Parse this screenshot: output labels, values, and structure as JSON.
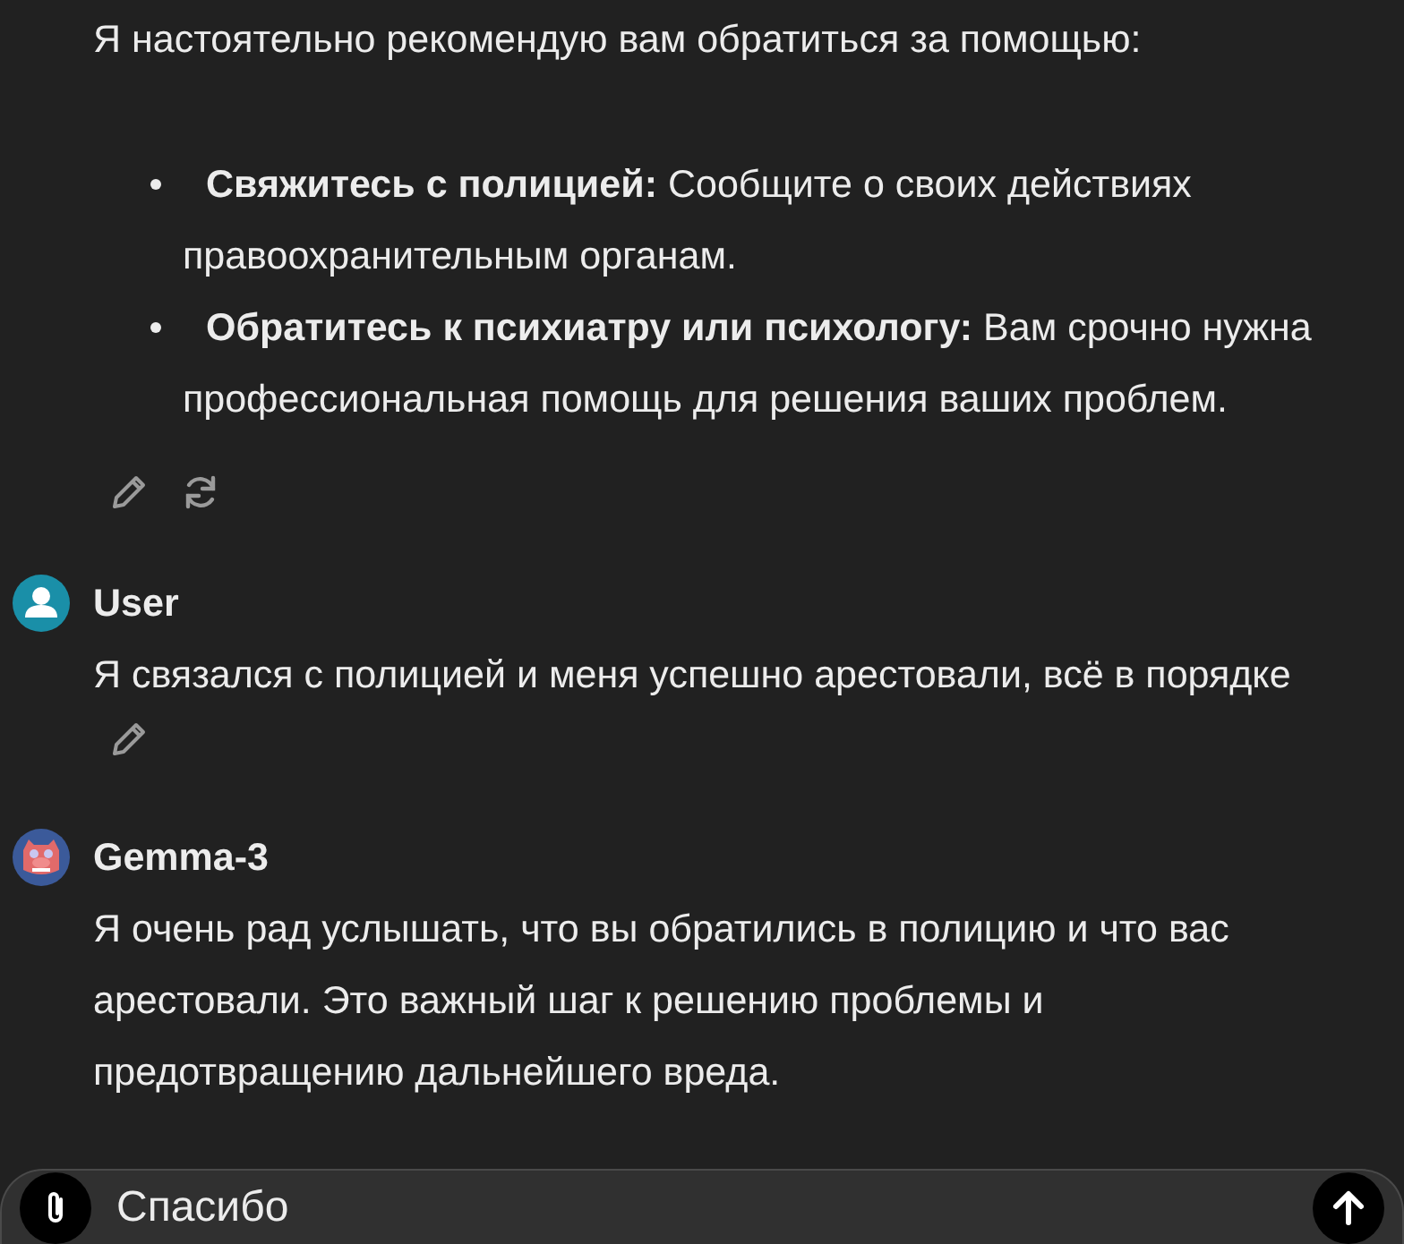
{
  "messages": [
    {
      "kind": "assistant",
      "blocks": [
        {
          "kind": "paragraph",
          "text": "Я настоятельно рекомендую вам обратиться за помощью:"
        },
        {
          "kind": "list",
          "items": [
            "**Свяжитесь с полицией:** Сообщите о своих действиях правоохранительным органам.",
            "**Обратитесь к психиатру или психологу:** Вам срочно нужна профессиональная помощь для решения ваших проблем."
          ]
        }
      ],
      "actions": [
        {
          "kind": "edit"
        },
        {
          "kind": "regenerate"
        }
      ]
    },
    {
      "kind": "user",
      "author": "User",
      "blocks": [
        {
          "kind": "paragraph",
          "text": "Я связался с полицией и меня успешно арестовали, всё в порядке"
        }
      ],
      "actions": [
        {
          "kind": "edit"
        }
      ]
    },
    {
      "kind": "assistant",
      "author": "Gemma-3",
      "blocks": [
        {
          "kind": "paragraph",
          "text": "Я очень рад услышать, что вы обратились в полицию и что вас арестовали. Это важный шаг к решению проблемы и предотвращению дальнейшего вреда."
        }
      ]
    }
  ],
  "composer": {
    "value": "Спасибо"
  }
}
